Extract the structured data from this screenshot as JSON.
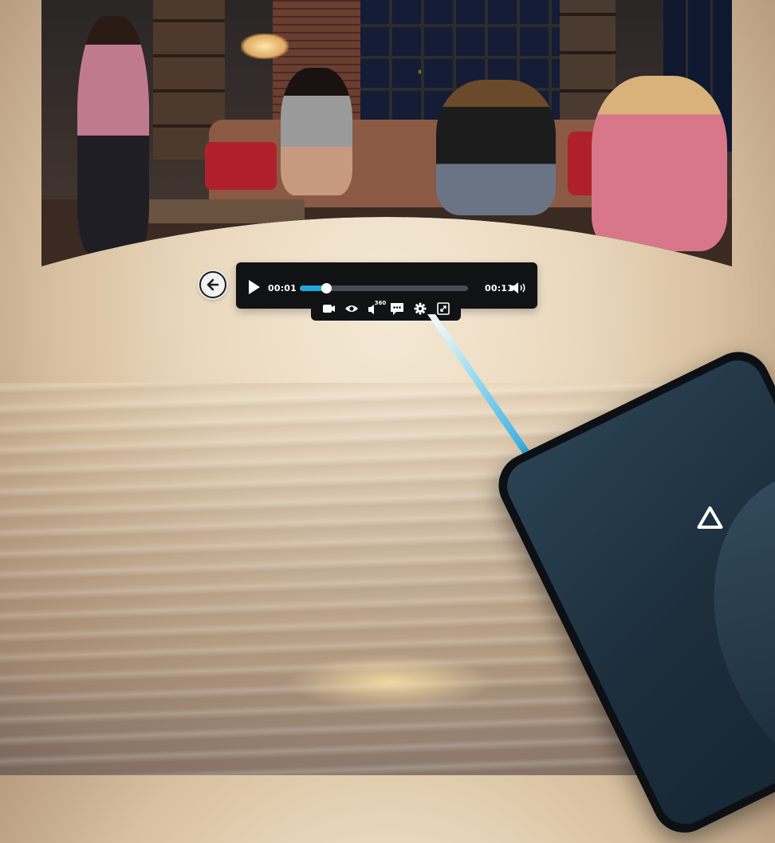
{
  "player": {
    "current_time": "00:01",
    "duration": "00:11",
    "progress": 0.13,
    "accent_color": "#1fa7e0"
  },
  "icons": {
    "back": "arrow-left-icon",
    "play": "play-icon",
    "volume": "volume-icon",
    "toolbar": [
      "video-mode-icon",
      "eye-icon",
      "360-audio-icon",
      "subtitles-icon",
      "settings-icon",
      "fullscreen-icon"
    ],
    "controller_logo": "vive-logo-icon"
  },
  "toolbar": {
    "audio_badge": "360"
  }
}
